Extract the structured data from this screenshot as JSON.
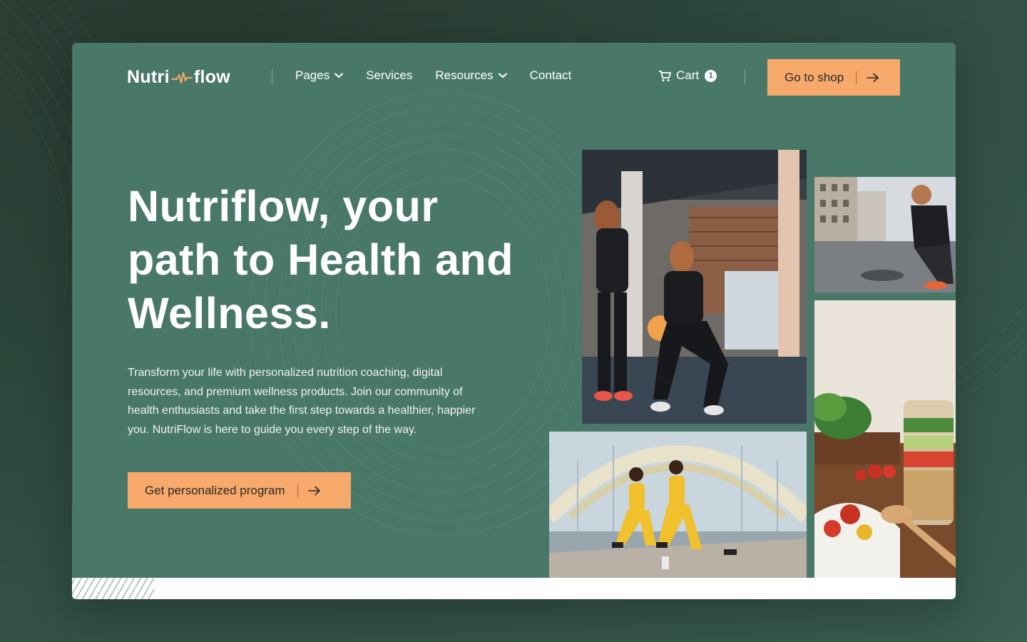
{
  "brand": {
    "name_left": "Nutri",
    "name_right": "flow",
    "accent_color": "#f7a86b",
    "panel_color": "#4a7868"
  },
  "nav": {
    "items": [
      {
        "label": "Pages",
        "dropdown": true
      },
      {
        "label": "Services",
        "dropdown": false
      },
      {
        "label": "Resources",
        "dropdown": true
      },
      {
        "label": "Contact",
        "dropdown": false
      }
    ],
    "cart_label": "Cart",
    "cart_count": "1",
    "shop_button": "Go to shop"
  },
  "hero": {
    "title": "Nutriflow, your path to Health and Wellness.",
    "description": "Transform your life with personalized nutrition coaching, digital resources, and premium wellness products. Join our community of health enthusiasts and take the first step towards a healthier, happier you. NutriFlow is here to guide you every step of the way.",
    "cta": "Get personalized program"
  },
  "images": [
    {
      "icon": "trainer-squat-photo"
    },
    {
      "icon": "runner-tying-shoe-photo"
    },
    {
      "icon": "women-lunges-bridge-photo"
    },
    {
      "icon": "salad-jar-food-photo"
    }
  ]
}
